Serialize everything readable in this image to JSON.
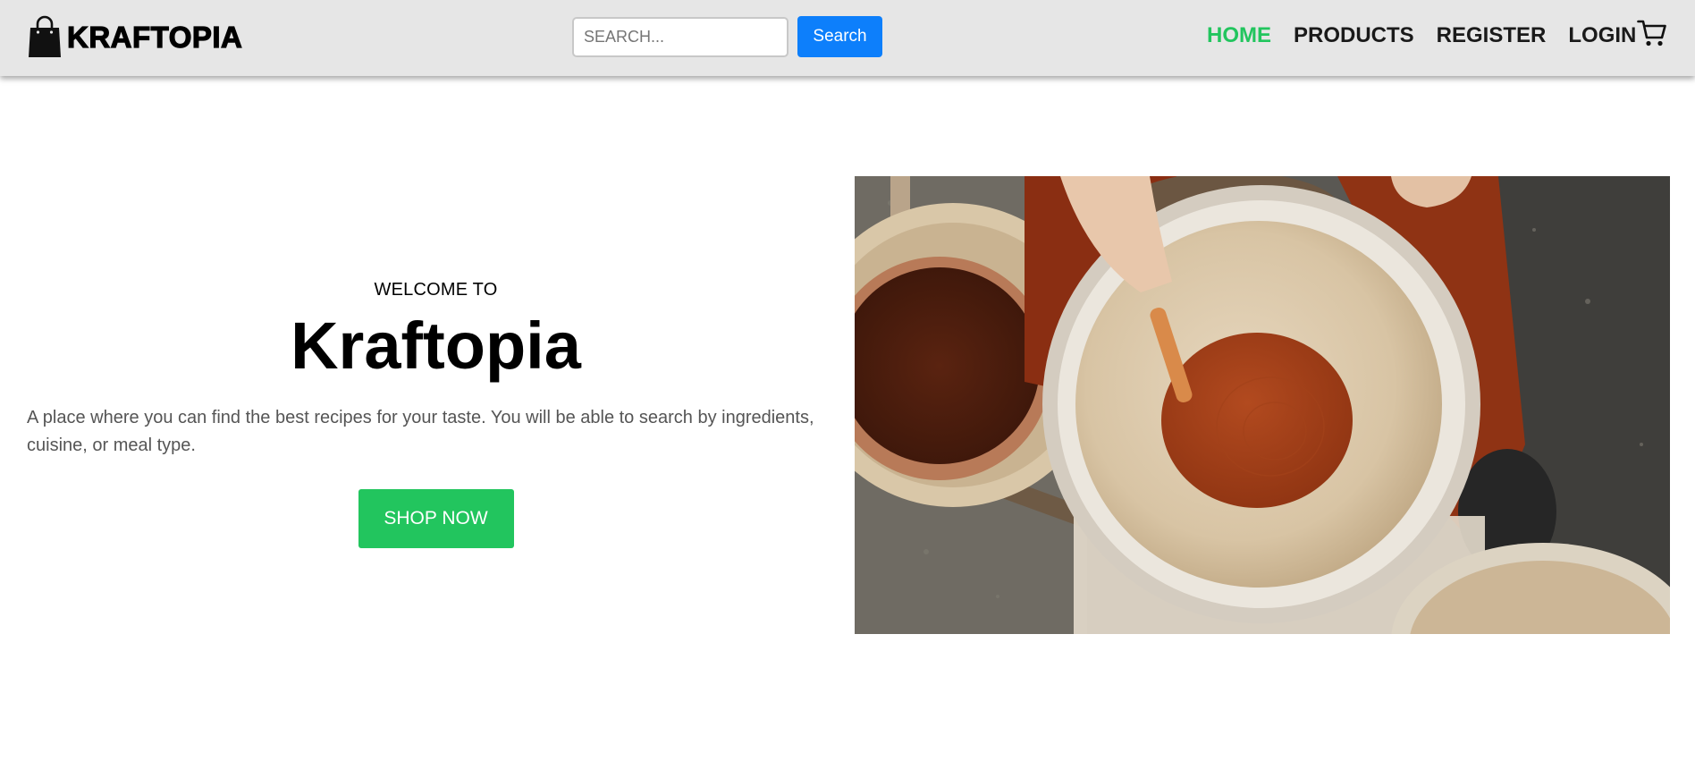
{
  "header": {
    "brand_name": "KRAFTOPIA",
    "brand_icon": "shopping-bag-icon",
    "search": {
      "placeholder": "SEARCH...",
      "value": "",
      "button_label": "Search"
    },
    "nav": [
      {
        "label": "HOME",
        "active": true
      },
      {
        "label": "PRODUCTS",
        "active": false
      },
      {
        "label": "REGISTER",
        "active": false
      },
      {
        "label": "LOGIN",
        "active": false
      }
    ],
    "cart_icon": "shopping-cart-icon"
  },
  "hero": {
    "kicker": "WELCOME TO",
    "title": "Kraftopia",
    "description": "A place where you can find the best recipes for your taste. You will be able to search by ingredients, cuisine, or meal type.",
    "cta_label": "SHOP NOW",
    "image_subject": "pottery-wheel-photo"
  },
  "colors": {
    "header_bg": "#e6e6e6",
    "accent_green": "#22c55e",
    "search_blue": "#0d7ffb",
    "text_dark": "#000000",
    "text_muted": "#555555"
  }
}
